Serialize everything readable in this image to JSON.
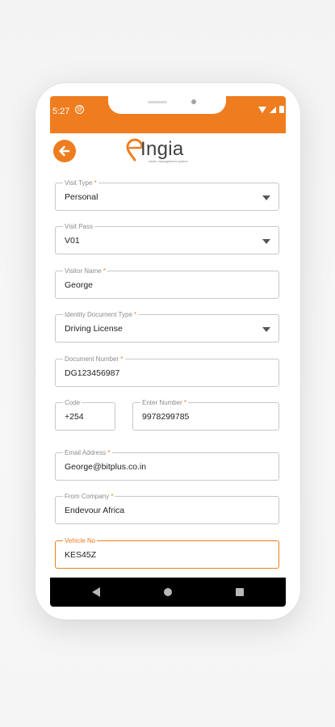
{
  "status_bar": {
    "time": "5:27",
    "notification_icon": "at-sign-icon"
  },
  "header": {
    "back_icon": "arrow-left-icon",
    "logo_text": "Ingia",
    "logo_tagline": "visitor management system"
  },
  "colors": {
    "accent": "#ef7d1f",
    "border": "#c8c8c8",
    "label": "#8c8c8c"
  },
  "form": {
    "visit_type": {
      "label": "Visit Type",
      "required": true,
      "value": "Personal"
    },
    "visit_pass": {
      "label": "Visit Pass",
      "required": false,
      "value": "V01"
    },
    "visitor_name": {
      "label": "Visitor Name",
      "required": true,
      "value": "George"
    },
    "identity_document_type": {
      "label": "Identity Document Type",
      "required": true,
      "value": "Driving License"
    },
    "document_number": {
      "label": "Document Number",
      "required": true,
      "value": "DG123456987"
    },
    "code": {
      "label": "Code",
      "required": false,
      "value": "+254"
    },
    "enter_number": {
      "label": "Enter Number",
      "required": true,
      "value": "9978299785"
    },
    "email_address": {
      "label": "Email Address",
      "required": true,
      "value": "George@bitplus.co.in"
    },
    "from_company": {
      "label": "From Company",
      "required": true,
      "value": "Endevour Africa"
    },
    "vehicle_no": {
      "label": "Vehicle No",
      "required": false,
      "value": "KES45Z"
    }
  },
  "req_marker": "*",
  "nav": {
    "back": "nav-back-icon",
    "home": "nav-home-icon",
    "recent": "nav-recent-icon"
  }
}
